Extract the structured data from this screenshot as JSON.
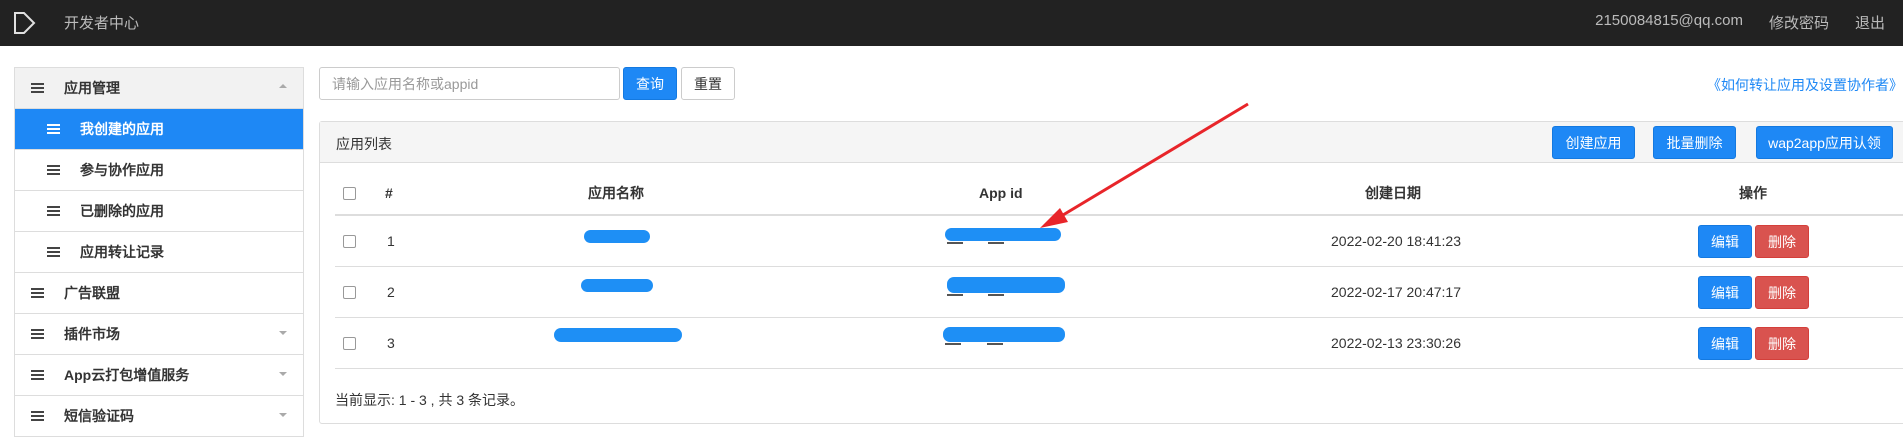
{
  "navbar": {
    "title": "开发者中心",
    "user_email": "2150084815@qq.com",
    "change_password": "修改密码",
    "logout": "退出"
  },
  "sidebar": {
    "groups": [
      {
        "label": "应用管理",
        "expanded": true
      },
      {
        "label": "广告联盟"
      },
      {
        "label": "插件市场"
      },
      {
        "label": "App云打包增值服务"
      },
      {
        "label": "短信验证码"
      }
    ],
    "sub_items": [
      {
        "label": "我创建的应用",
        "active": true
      },
      {
        "label": "参与协作应用"
      },
      {
        "label": "已删除的应用"
      },
      {
        "label": "应用转让记录"
      }
    ]
  },
  "search": {
    "placeholder": "请输入应用名称或appid",
    "query_button": "查询",
    "reset_button": "重置"
  },
  "help_link": "《如何转让应用及设置协作者》",
  "panel": {
    "title": "应用列表",
    "create_button": "创建应用",
    "batch_delete_button": "批量删除",
    "wap2app_button": "wap2app应用认领"
  },
  "table": {
    "headers": [
      "#",
      "应用名称",
      "App id",
      "创建日期",
      "操作"
    ],
    "rows": [
      {
        "index": "1",
        "created": "2022-02-20 18:41:23",
        "edit": "编辑",
        "delete": "删除"
      },
      {
        "index": "2",
        "created": "2022-02-17 20:47:17",
        "edit": "编辑",
        "delete": "删除"
      },
      {
        "index": "3",
        "created": "2022-02-13 23:30:26",
        "edit": "编辑",
        "delete": "删除"
      }
    ]
  },
  "footer": "当前显示: 1 - 3 , 共 3 条记录。",
  "colors": {
    "navbar_bg": "#222222",
    "primary": "#1e88f5",
    "danger": "#d9534f",
    "annotation_arrow": "#e8252a"
  }
}
